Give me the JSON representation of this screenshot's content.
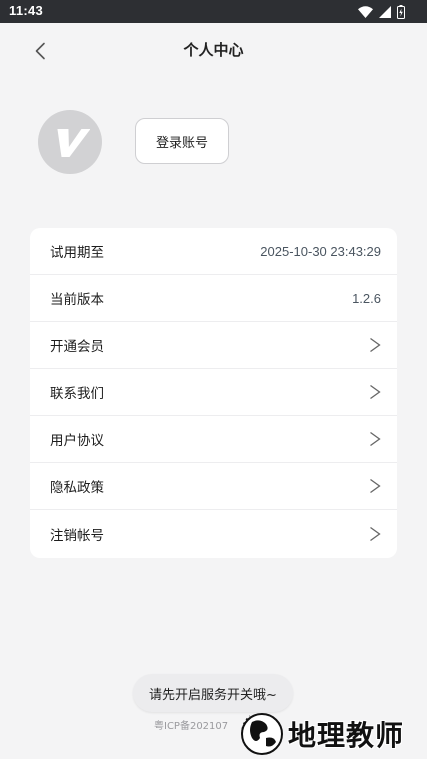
{
  "status_bar": {
    "time": "11:43",
    "icons": [
      "wifi-icon",
      "signal-icon",
      "battery-icon"
    ]
  },
  "header": {
    "title": "个人中心",
    "back_icon": "chevron-left-icon"
  },
  "profile": {
    "avatar_icon": "v-logo-icon",
    "login_label": "登录账号"
  },
  "menu": {
    "rows": [
      {
        "label": "试用期至",
        "value": "2025-10-30 23:43:29"
      },
      {
        "label": "当前版本",
        "value": "1.2.6"
      },
      {
        "label": "开通会员",
        "icon": "chevron-right-icon"
      },
      {
        "label": "联系我们",
        "icon": "chevron-right-icon"
      },
      {
        "label": "用户协议",
        "icon": "chevron-right-icon"
      },
      {
        "label": "隐私政策",
        "icon": "chevron-right-icon"
      },
      {
        "label": "注销帐号",
        "icon": "chevron-right-icon"
      }
    ]
  },
  "toast": {
    "text": "请先开启服务开关哦~"
  },
  "footer": {
    "icp": "粤ICP备202107"
  },
  "watermark": {
    "text": "地理教师"
  },
  "colors": {
    "status_bar_bg": "#2d2f33",
    "page_bg": "#f4f4f5",
    "card_bg": "#ffffff",
    "value_text": "#4a5560"
  }
}
